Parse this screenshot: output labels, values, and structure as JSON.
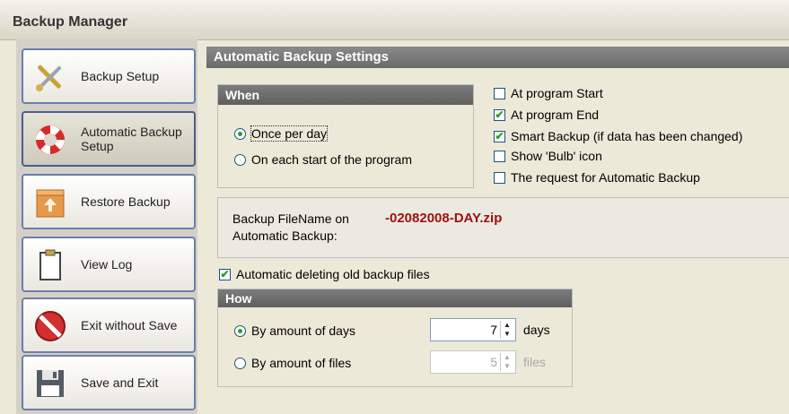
{
  "window": {
    "title": "Backup Manager"
  },
  "sidebar": {
    "items": [
      {
        "label": "Backup Setup",
        "icon": "tools-icon"
      },
      {
        "label": "Automatic Backup Setup",
        "icon": "lifebuoy-icon"
      },
      {
        "label": "Restore Backup",
        "icon": "restore-box-icon"
      },
      {
        "label": "View Log",
        "icon": "clipboard-icon"
      },
      {
        "label": "Exit without Save",
        "icon": "no-entry-icon"
      },
      {
        "label": "Save and Exit",
        "icon": "floppy-disk-icon"
      }
    ],
    "active_index": 1
  },
  "main": {
    "header": "Automatic Backup Settings",
    "when": {
      "title": "When",
      "options": [
        "Once per day",
        "On each start of the program"
      ],
      "selected": 0
    },
    "checks": [
      {
        "label": "At program Start",
        "checked": false
      },
      {
        "label": "At program End",
        "checked": true
      },
      {
        "label": "Smart Backup (if data has been changed)",
        "checked": true
      },
      {
        "label": "Show 'Bulb' icon",
        "checked": false
      },
      {
        "label": "The request for Automatic Backup",
        "checked": false
      }
    ],
    "filename": {
      "label_line1": "Backup FileName on",
      "label_line2": "Automatic Backup:",
      "value": "-02082008-DAY.zip",
      "value_color": "#a01010"
    },
    "auto_delete": {
      "label": "Automatic deleting old backup files",
      "checked": true
    },
    "how": {
      "title": "How",
      "days": {
        "label": "By amount of days",
        "value": "7",
        "unit": "days",
        "selected": true
      },
      "files": {
        "label": "By amount of files",
        "value": "5",
        "unit": "files",
        "selected": false
      }
    }
  }
}
